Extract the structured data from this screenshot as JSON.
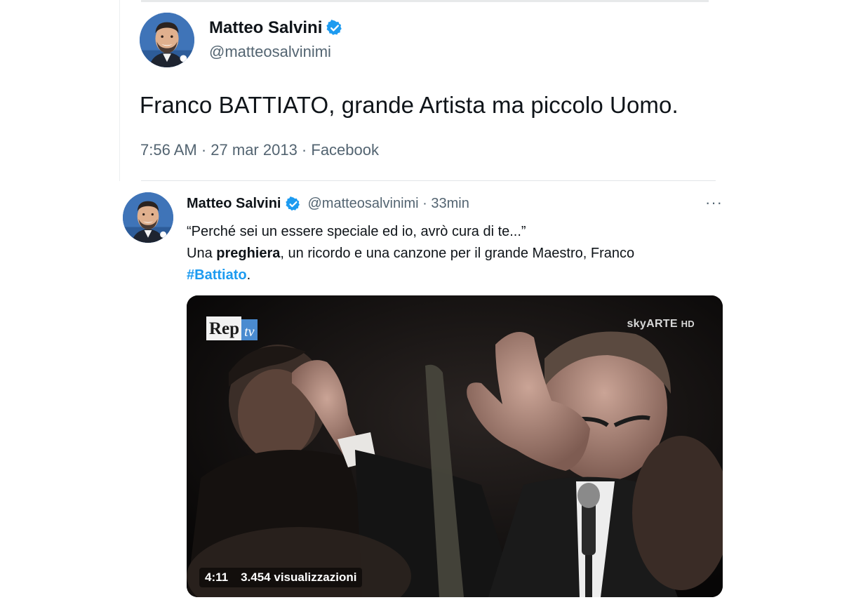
{
  "tweet_top": {
    "display_name": "Matteo Salvini",
    "handle": "@matteosalvinimi",
    "text": "Franco BATTIATO, grande Artista ma piccolo Uomo.",
    "time": "7:56 AM",
    "date": "27 mar 2013",
    "source": "Facebook",
    "separator": " · "
  },
  "tweet_reply": {
    "display_name": "Matteo Salvini",
    "handle": "@matteosalvinimi",
    "age": "33min",
    "separator": " · ",
    "more_label": "···",
    "line1": "“Perché sei un essere speciale ed io, avrò cura di te...”",
    "line2_prefix": "Una ",
    "line2_bold": "preghiera",
    "line2_suffix": ", un ricordo e una canzone per il grande Maestro, Franco",
    "hashtag": "#Battiato",
    "line3_suffix": "."
  },
  "video": {
    "logo_rep": "Rep",
    "logo_tv": "tv",
    "channel_sky": "sky",
    "channel_arte": "ARTE",
    "channel_hd": "HD",
    "duration": "4:11",
    "views": "3.454 visualizzazioni"
  },
  "colors": {
    "verified_blue": "#1d9bf0",
    "hashtag_blue": "#1d9bf0",
    "secondary_text": "#536471"
  }
}
